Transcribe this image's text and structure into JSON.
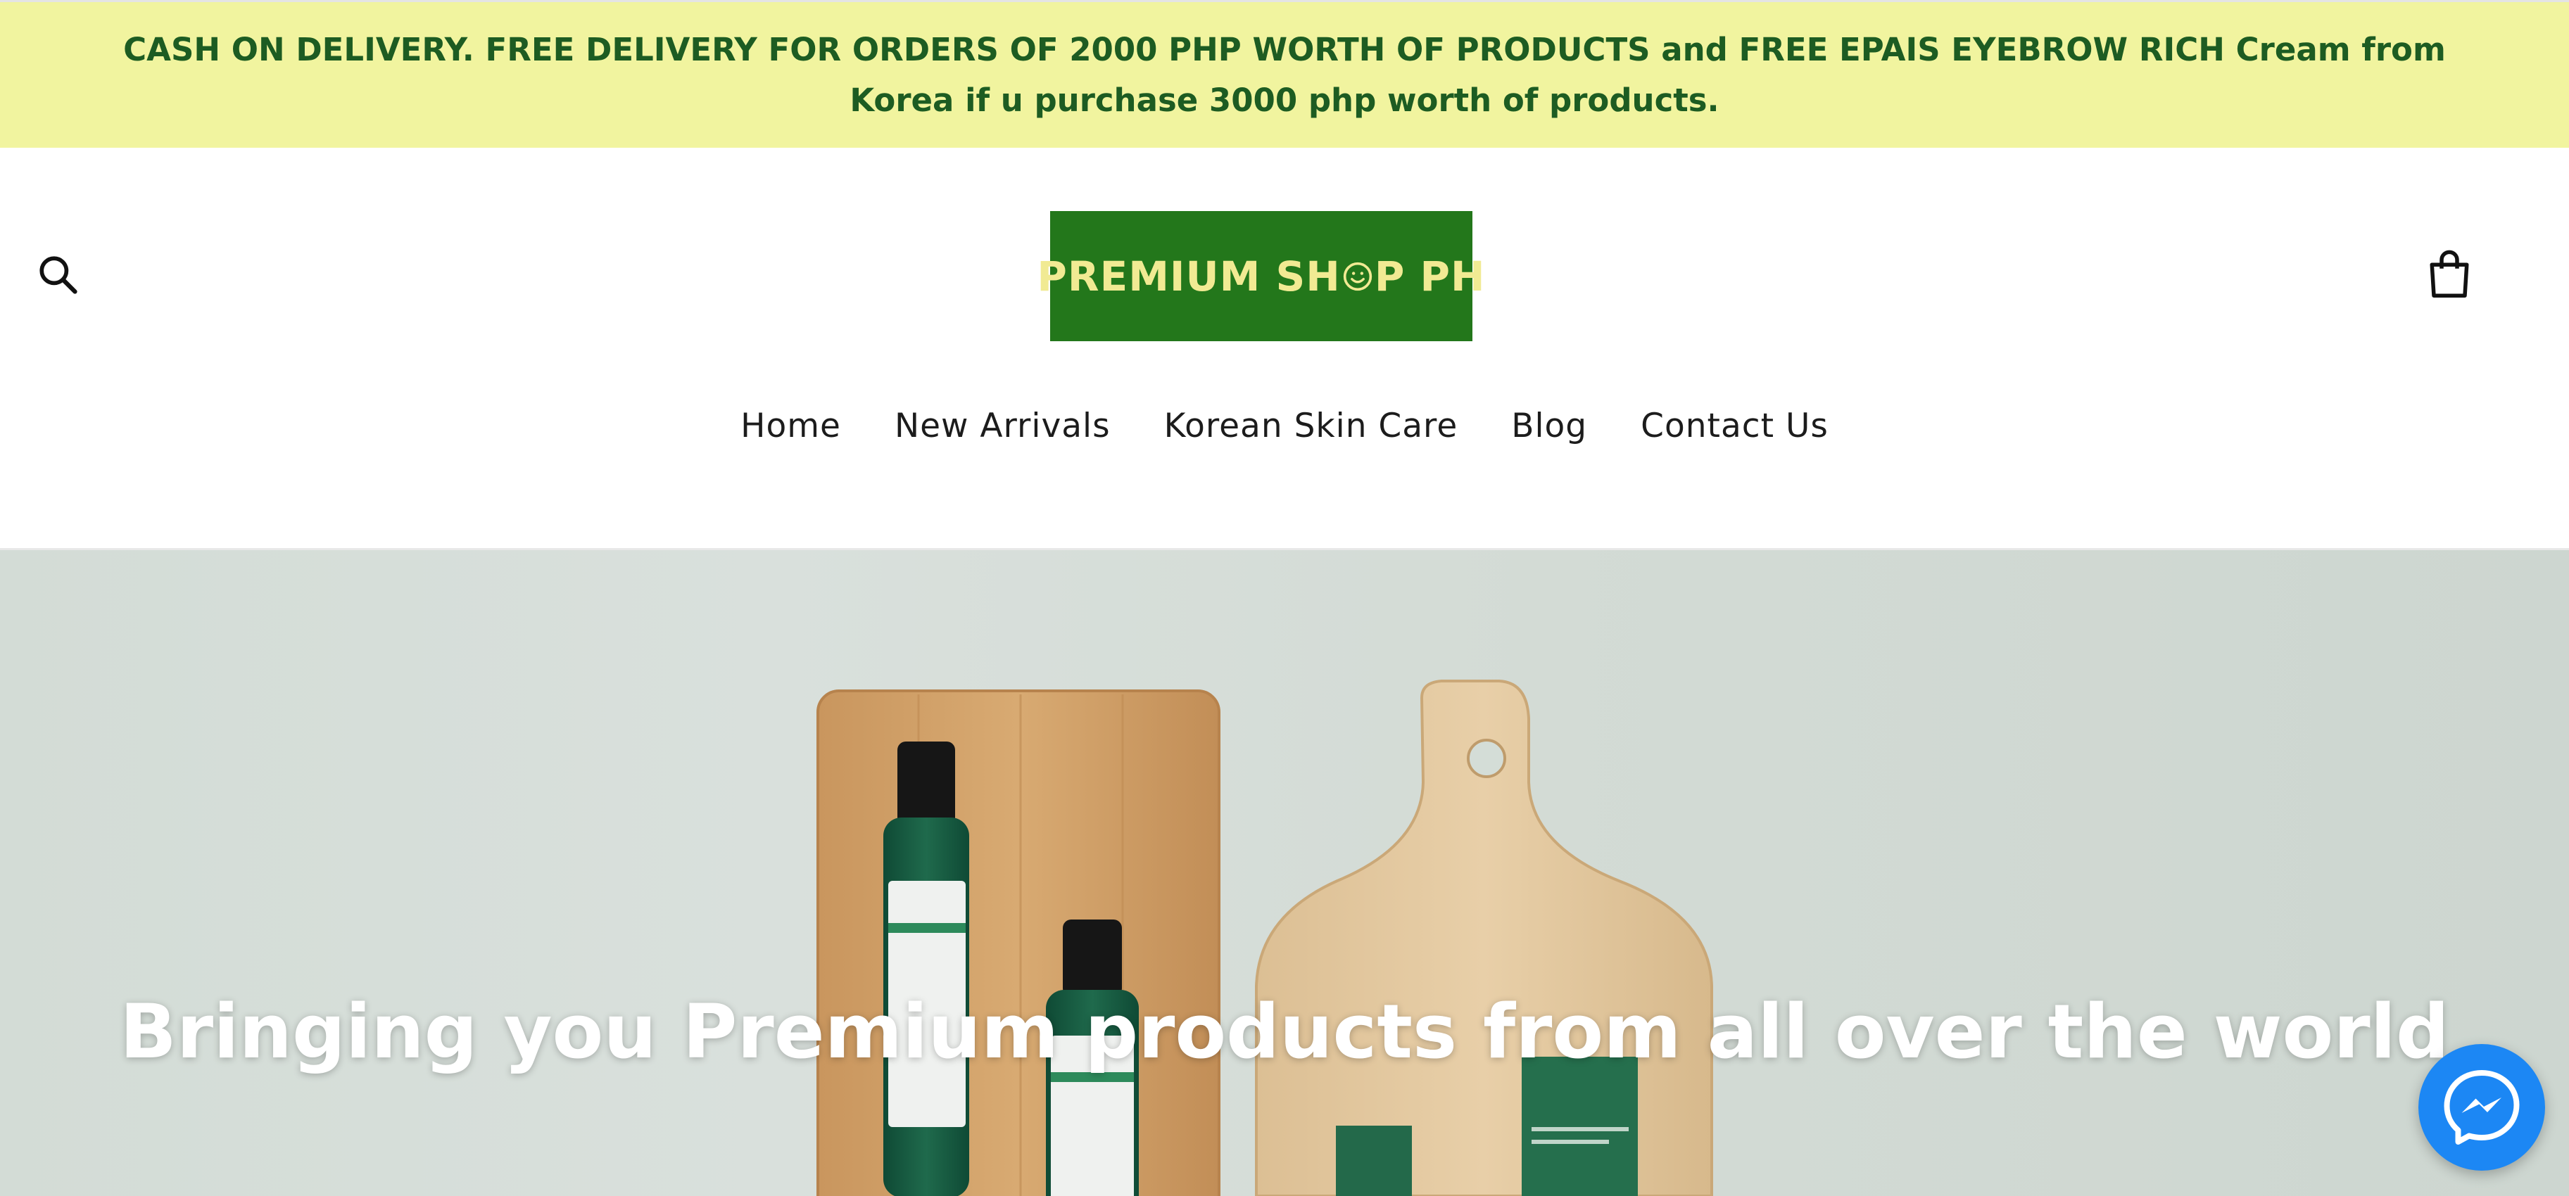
{
  "announcement": {
    "text": "CASH ON DELIVERY. FREE DELIVERY FOR ORDERS OF 2000 PHP WORTH OF PRODUCTS and FREE EPAIS EYEBROW RICH Cream from Korea if u purchase 3000 php worth of products."
  },
  "header": {
    "logo": {
      "text_before": "PREMIUM SH",
      "text_after": "P PH",
      "background_color": "#23771b",
      "text_color": "#f1ea93"
    },
    "search_icon": "search-icon",
    "cart_icon": "shopping-bag-icon"
  },
  "nav": {
    "items": [
      {
        "label": "Home"
      },
      {
        "label": "New Arrivals"
      },
      {
        "label": "Korean Skin Care"
      },
      {
        "label": "Blog"
      },
      {
        "label": "Contact Us"
      }
    ]
  },
  "hero": {
    "title": "Bringing you Premium products from all over the world"
  },
  "widgets": {
    "messenger_icon": "messenger-icon",
    "messenger_color": "#1c87f4"
  },
  "colors": {
    "announcement_bg": "#f1f49f",
    "announcement_text": "#1d5c22"
  }
}
